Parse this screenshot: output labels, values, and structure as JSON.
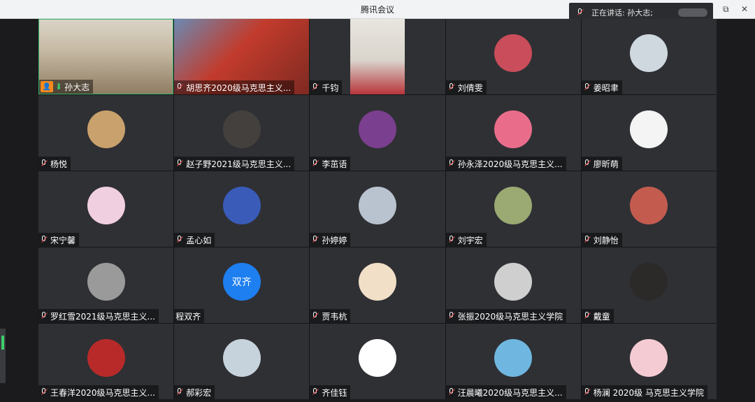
{
  "window": {
    "title": "腾讯会议",
    "restore_glyph": "⧉",
    "close_glyph": "✕"
  },
  "speaking": {
    "label": "正在讲话: 孙大志;"
  },
  "host_glyph": "👤",
  "down_glyph": "⬇",
  "participants": [
    {
      "name": "孙大志",
      "host": true,
      "video": "bookshelf"
    },
    {
      "name": "胡思齐2020级马克思主义...",
      "video": "temple"
    },
    {
      "name": "千钧",
      "video": "man-red"
    },
    {
      "name": "刘倩雯",
      "avatar": "#c94d5a"
    },
    {
      "name": "姜昭聿",
      "avatar": "#cfd7df"
    },
    {
      "name": "杨悦",
      "avatar": "#c9a16c"
    },
    {
      "name": "赵子野2021级马克思主义...",
      "avatar": "#44403e"
    },
    {
      "name": "李茁语",
      "avatar": "#7b3f8f"
    },
    {
      "name": "孙永泽2020级马克思主义...",
      "avatar": "#e96d8b"
    },
    {
      "name": "廖昕萌",
      "avatar": "#f4f4f4"
    },
    {
      "name": "宋宁馨",
      "avatar": "#f0cfe0"
    },
    {
      "name": "孟心如",
      "avatar": "#3a5bb8"
    },
    {
      "name": "孙婷婷",
      "avatar": "#b9c3cf"
    },
    {
      "name": "刘宇宏",
      "avatar": "#9aaa72"
    },
    {
      "name": "刘静怡",
      "avatar": "#c35b4f"
    },
    {
      "name": "罗红雪2021级马克思主义...",
      "avatar": "#9a9a9a"
    },
    {
      "name": "程双齐",
      "avatar": "#1e7ff0",
      "text": "双齐",
      "nomic": true
    },
    {
      "name": "贾韦杭",
      "avatar": "#f1dfc8"
    },
    {
      "name": "张振2020级马克思主义学院",
      "avatar": "#cfcfcf"
    },
    {
      "name": "戴童",
      "avatar": "#2c2a28"
    },
    {
      "name": "王春洋2020级马克思主义...",
      "avatar": "#b82a2a"
    },
    {
      "name": "郝彩宏",
      "avatar": "#c7d3dc"
    },
    {
      "name": "齐佳钰",
      "avatar": "#ffffff"
    },
    {
      "name": "汪晨曦2020级马克思主义...",
      "avatar": "#6fb7e0"
    },
    {
      "name": "杨澜 2020级 马克思主义学院",
      "avatar": "#f5cbd3"
    }
  ]
}
